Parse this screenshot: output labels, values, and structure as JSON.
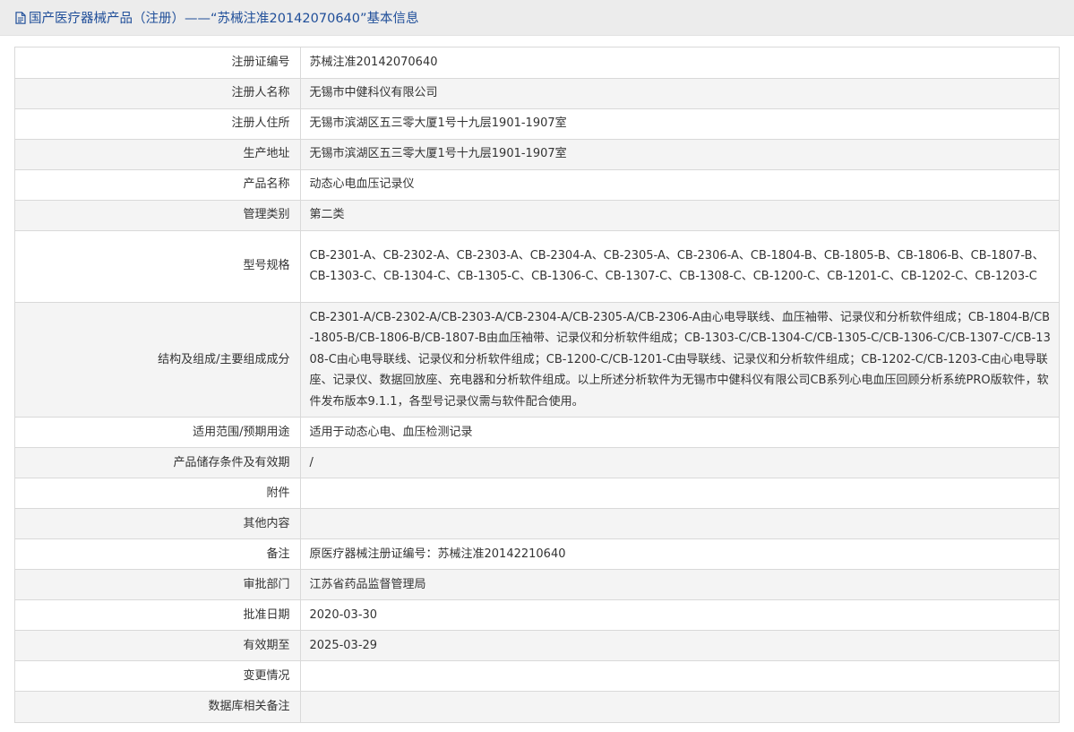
{
  "header": {
    "title": "国产医疗器械产品（注册）——“苏械注准20142070640”基本信息",
    "icon": "document-icon"
  },
  "rows": [
    {
      "label": "注册证编号",
      "value": "苏械注准20142070640"
    },
    {
      "label": "注册人名称",
      "value": "无锡市中健科仪有限公司"
    },
    {
      "label": "注册人住所",
      "value": "无锡市滨湖区五三零大厦1号十九层1901-1907室"
    },
    {
      "label": "生产地址",
      "value": "无锡市滨湖区五三零大厦1号十九层1901-1907室"
    },
    {
      "label": "产品名称",
      "value": "动态心电血压记录仪"
    },
    {
      "label": "管理类别",
      "value": "第二类"
    },
    {
      "label": "型号规格",
      "value": "CB-2301-A、CB-2302-A、CB-2303-A、CB-2304-A、CB-2305-A、CB-2306-A、CB-1804-B、CB-1805-B、CB-1806-B、CB-1807-B、CB-1303-C、CB-1304-C、CB-1305-C、CB-1306-C、CB-1307-C、CB-1308-C、CB-1200-C、CB-1201-C、CB-1202-C、CB-1203-C"
    },
    {
      "label": "结构及组成/主要组成成分",
      "value": "CB-2301-A/CB-2302-A/CB-2303-A/CB-2304-A/CB-2305-A/CB-2306-A由心电导联线、血压袖带、记录仪和分析软件组成；CB-1804-B/CB-1805-B/CB-1806-B/CB-1807-B由血压袖带、记录仪和分析软件组成；CB-1303-C/CB-1304-C/CB-1305-C/CB-1306-C/CB-1307-C/CB-1308-C由心电导联线、记录仪和分析软件组成；CB-1200-C/CB-1201-C由导联线、记录仪和分析软件组成；CB-1202-C/CB-1203-C由心电导联座、记录仪、数据回放座、充电器和分析软件组成。以上所述分析软件为无锡市中健科仪有限公司CB系列心电血压回顾分析系统PRO版软件，软件发布版本9.1.1，各型号记录仪需与软件配合使用。"
    },
    {
      "label": "适用范围/预期用途",
      "value": "适用于动态心电、血压检测记录"
    },
    {
      "label": "产品储存条件及有效期",
      "value": "/"
    },
    {
      "label": "附件",
      "value": ""
    },
    {
      "label": "其他内容",
      "value": ""
    },
    {
      "label": "备注",
      "value": "原医疗器械注册证编号：苏械注准20142210640"
    },
    {
      "label": "审批部门",
      "value": "江苏省药品监督管理局"
    },
    {
      "label": "批准日期",
      "value": "2020-03-30"
    },
    {
      "label": "有效期至",
      "value": "2025-03-29"
    },
    {
      "label": "变更情况",
      "value": ""
    },
    {
      "label": "数据库相关备注",
      "value": ""
    }
  ]
}
